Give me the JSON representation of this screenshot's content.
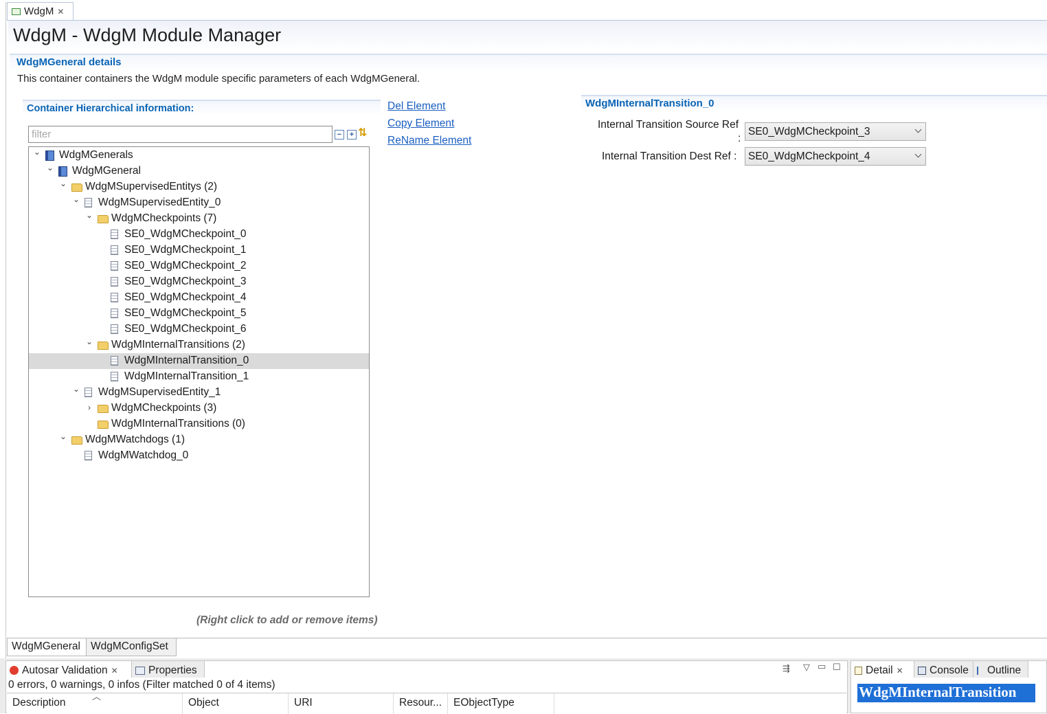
{
  "editor_tab": {
    "label": "WdgM"
  },
  "page": {
    "title": "WdgM - WdgM Module Manager",
    "section_title": "WdgMGeneral details",
    "section_description": "This container containers the WdgM module specific parameters of each WdgMGeneral."
  },
  "hierarchy": {
    "title": "Container Hierarchical information:",
    "filter_placeholder": "filter",
    "tree": [
      {
        "label": "WdgMGenerals",
        "depth": 0,
        "icon": "book-icon",
        "expanded": true
      },
      {
        "label": "WdgMGeneral",
        "depth": 1,
        "icon": "book-icon",
        "expanded": true
      },
      {
        "label": "WdgMSupervisedEntitys (2)",
        "depth": 2,
        "icon": "folder-icon",
        "expanded": true
      },
      {
        "label": "WdgMSupervisedEntity_0",
        "depth": 3,
        "icon": "file-icon",
        "expanded": true
      },
      {
        "label": "WdgMCheckpoints (7)",
        "depth": 4,
        "icon": "folder-icon",
        "expanded": true
      },
      {
        "label": "SE0_WdgMCheckpoint_0",
        "depth": 5,
        "icon": "file-icon"
      },
      {
        "label": "SE0_WdgMCheckpoint_1",
        "depth": 5,
        "icon": "file-icon"
      },
      {
        "label": "SE0_WdgMCheckpoint_2",
        "depth": 5,
        "icon": "file-icon"
      },
      {
        "label": "SE0_WdgMCheckpoint_3",
        "depth": 5,
        "icon": "file-icon"
      },
      {
        "label": "SE0_WdgMCheckpoint_4",
        "depth": 5,
        "icon": "file-icon"
      },
      {
        "label": "SE0_WdgMCheckpoint_5",
        "depth": 5,
        "icon": "file-icon"
      },
      {
        "label": "SE0_WdgMCheckpoint_6",
        "depth": 5,
        "icon": "file-icon"
      },
      {
        "label": "WdgMInternalTransitions (2)",
        "depth": 4,
        "icon": "folder-icon",
        "expanded": true
      },
      {
        "label": "WdgMInternalTransition_0",
        "depth": 5,
        "icon": "file-icon",
        "selected": true
      },
      {
        "label": "WdgMInternalTransition_1",
        "depth": 5,
        "icon": "file-icon"
      },
      {
        "label": "WdgMSupervisedEntity_1",
        "depth": 3,
        "icon": "file-icon",
        "expanded": true
      },
      {
        "label": "WdgMCheckpoints (3)",
        "depth": 4,
        "icon": "folder-icon",
        "expanded": false
      },
      {
        "label": "WdgMInternalTransitions (0)",
        "depth": 4,
        "icon": "folder-icon"
      },
      {
        "label": "WdgMWatchdogs (1)",
        "depth": 2,
        "icon": "folder-icon",
        "expanded": true
      },
      {
        "label": "WdgMWatchdog_0",
        "depth": 3,
        "icon": "file-icon"
      }
    ],
    "hint": "(Right click to add or remove items)"
  },
  "actions": {
    "del": "Del Element",
    "copy": "Copy Element",
    "rename": "ReName Element"
  },
  "detail": {
    "title": "WdgMInternalTransition_0",
    "source_label": "Internal Transition Source Ref",
    "source_colon": ":",
    "source_value": "SE0_WdgMCheckpoint_3",
    "dest_label": "Internal Transition Dest Ref :",
    "dest_value": "SE0_WdgMCheckpoint_4"
  },
  "page_tabs": [
    "WdgMGeneral",
    "WdgMConfigSet"
  ],
  "bottom": {
    "tabs": {
      "validation": "Autosar Validation",
      "properties": "Properties"
    },
    "status": "0 errors, 0 warnings, 0 infos (Filter matched 0 of 4 items)",
    "columns": [
      "Description",
      "Object",
      "URI",
      "Resour...",
      "EObjectType"
    ],
    "right_tabs": {
      "detail": "Detail",
      "console": "Console",
      "outline": "Outline"
    },
    "detail_text": "WdgMInternalTransition"
  },
  "colors": {
    "accent": "#0a64b4",
    "link": "#1a5ec0",
    "selection": "#1e6fd6"
  }
}
